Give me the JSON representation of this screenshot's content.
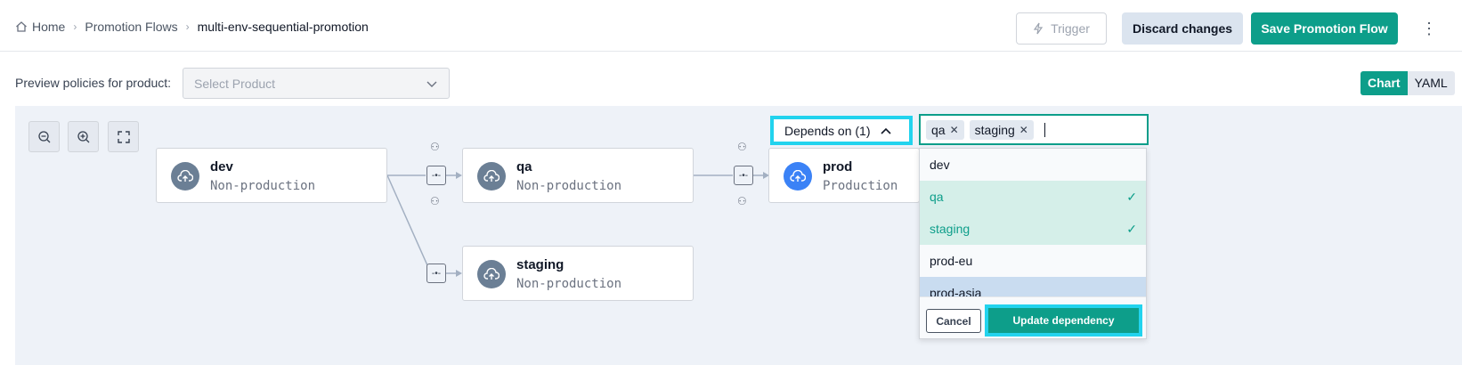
{
  "breadcrumb": {
    "home": "Home",
    "flows": "Promotion Flows",
    "current": "multi-env-sequential-promotion",
    "sep": "›"
  },
  "header": {
    "trigger": "Trigger",
    "discard": "Discard changes",
    "save": "Save Promotion Flow",
    "more": "⋮"
  },
  "preview": {
    "label": "Preview policies for product:",
    "placeholder": "Select Product"
  },
  "view_toggle": {
    "chart": "Chart",
    "yaml": "YAML",
    "selected": "Chart"
  },
  "nodes": [
    {
      "name": "dev",
      "type": "Non-production"
    },
    {
      "name": "qa",
      "type": "Non-production"
    },
    {
      "name": "prod",
      "type": "Production"
    },
    {
      "name": "staging",
      "type": "Non-production"
    }
  ],
  "depends": {
    "label": "Depends on (1)"
  },
  "combo": {
    "chips": [
      "qa",
      "staging"
    ]
  },
  "dropdown": {
    "options": [
      {
        "label": "dev",
        "selected": false
      },
      {
        "label": "qa",
        "selected": true
      },
      {
        "label": "staging",
        "selected": true
      },
      {
        "label": "prod-eu",
        "selected": false
      },
      {
        "label": "prod-asia",
        "selected": false
      }
    ],
    "cancel": "Cancel",
    "update": "Update dependency"
  },
  "colors": {
    "accent": "#0d9e8a",
    "highlight": "#22d3ee",
    "canvas": "#eef2f8",
    "production_icon": "#3b82f6",
    "nonprod_icon": "#6b7f95"
  },
  "icons": [
    "home-icon",
    "zoom-out-icon",
    "zoom-in-icon",
    "fullscreen-icon",
    "cloud-upload-icon",
    "lightning-icon",
    "chevron-down-icon",
    "chevron-up-icon",
    "check-icon",
    "close-icon",
    "kebab-icon",
    "connector-icon",
    "policy-icon"
  ]
}
